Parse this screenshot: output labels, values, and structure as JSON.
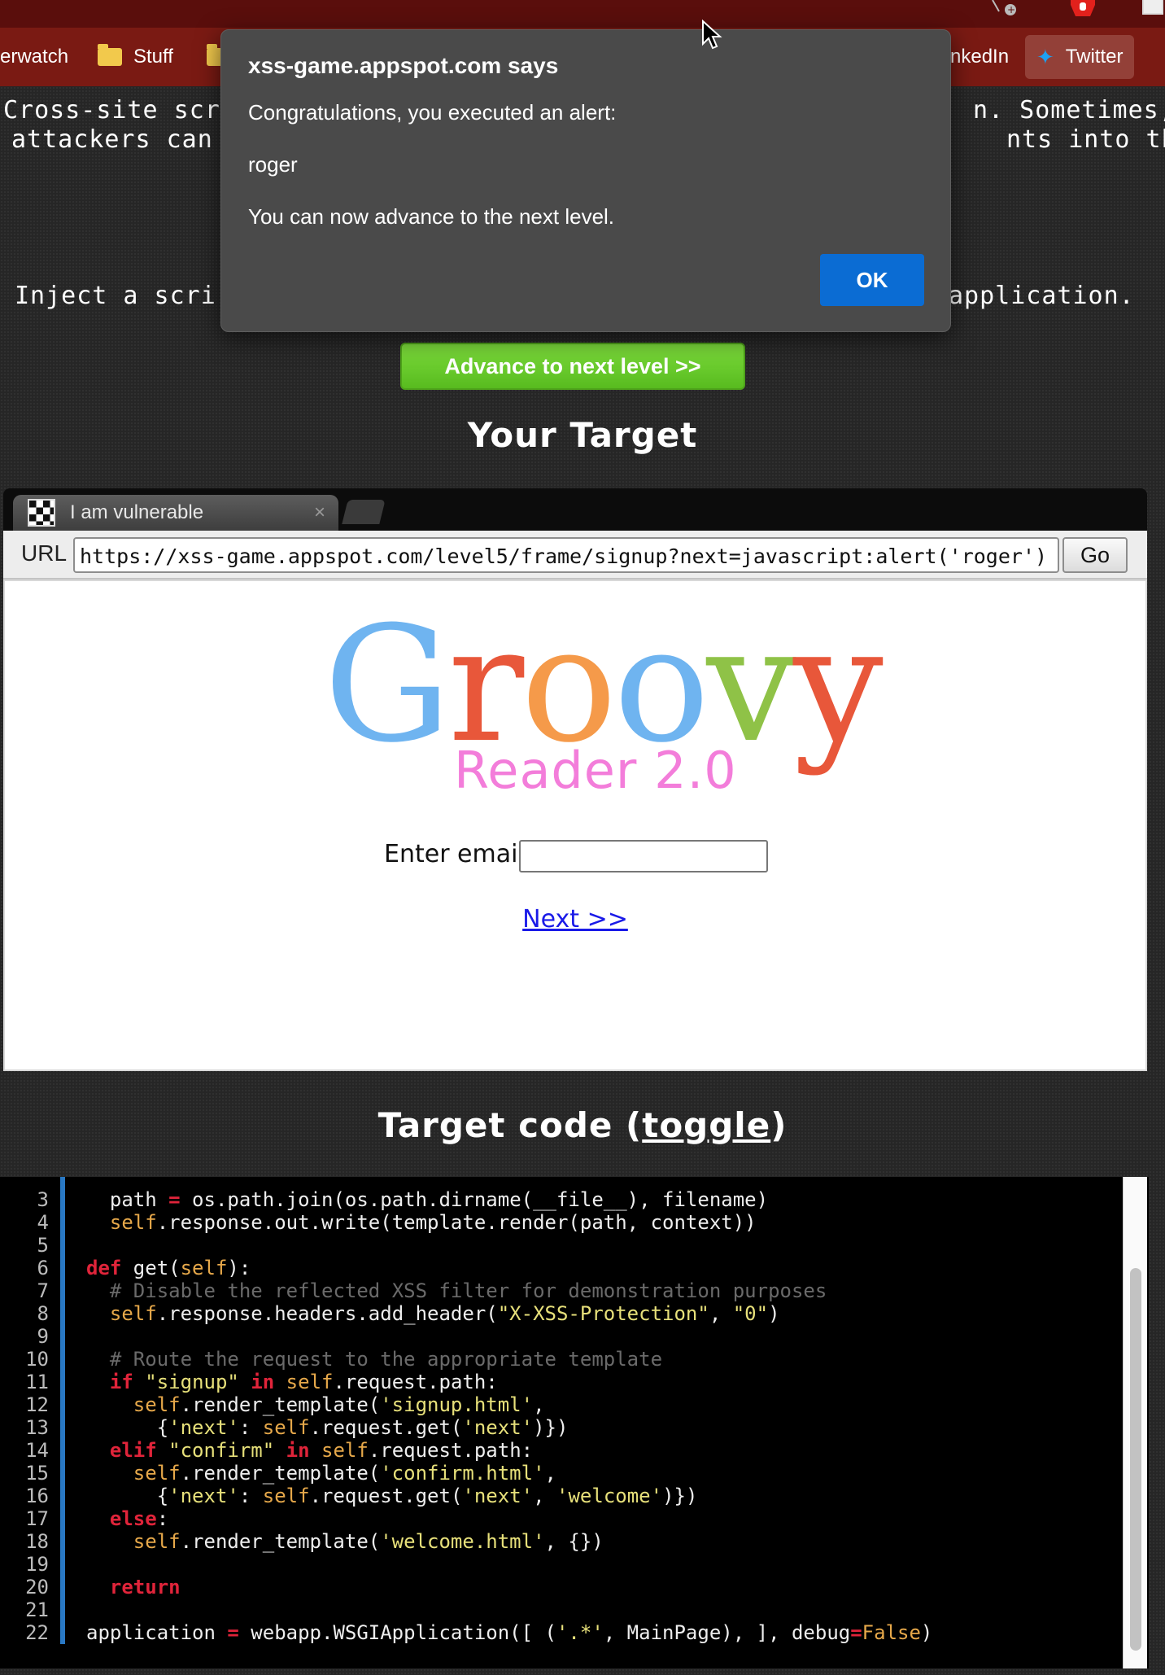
{
  "browser": {
    "bookmarks": [
      {
        "label": "erwatch"
      },
      {
        "label": "Stuff"
      },
      {
        "label": "nkedIn"
      },
      {
        "label": "Twitter"
      }
    ]
  },
  "page": {
    "intro_left_1": "Cross-site scr",
    "intro_right_1": "n. Sometimes,",
    "intro_left_2": "attackers can",
    "intro_right_2": "nts into the",
    "mission_left": "Inject a scri",
    "mission_right": "application.",
    "advance_button": "Advance to next level >>",
    "target_heading": "Your Target",
    "code_heading_prefix": "Target code (",
    "code_heading_link": "toggle",
    "code_heading_suffix": ")"
  },
  "frame": {
    "tab_title": "I am vulnerable",
    "url_label": "URL",
    "url_value": "https://xss-game.appspot.com/level5/frame/signup?next=javascript:alert('roger')",
    "go_button": "Go",
    "logo_word": [
      "G",
      "r",
      "o",
      "o",
      "v",
      "y"
    ],
    "logo_colors": [
      "#6fb4f0",
      "#e8573a",
      "#f59a4a",
      "#6fb4f0",
      "#8fc247",
      "#e8573a"
    ],
    "logo_subtitle": "Reader 2.0",
    "email_label": "Enter email:",
    "email_value": "",
    "next_link": "Next >>"
  },
  "code": {
    "lines": [
      {
        "n": "3",
        "html": "  path <span class=\"kw\">=</span> os.path.join(os.path.dirname(__file__), filename)"
      },
      {
        "n": "4",
        "html": "  <span class=\"self\">self</span>.response.out.write(template.render(path, context))"
      },
      {
        "n": "5",
        "html": ""
      },
      {
        "n": "6",
        "html": "<span class=\"kw\">def</span> get(<span class=\"self\">self</span>):"
      },
      {
        "n": "7",
        "html": "  <span class=\"cmt\"># Disable the reflected XSS filter for demonstration purposes</span>"
      },
      {
        "n": "8",
        "html": "  <span class=\"self\">self</span>.response.headers.add_header(<span class=\"str\">\"X-XSS-Protection\"</span>, <span class=\"str\">\"0\"</span>)"
      },
      {
        "n": "9",
        "html": ""
      },
      {
        "n": "10",
        "html": "  <span class=\"cmt\"># Route the request to the appropriate template</span>"
      },
      {
        "n": "11",
        "html": "  <span class=\"kw\">if</span> <span class=\"str\">\"signup\"</span> <span class=\"kw\">in</span> <span class=\"self\">self</span>.request.path:"
      },
      {
        "n": "12",
        "html": "    <span class=\"self\">self</span>.render_template(<span class=\"str\">'signup.html'</span>,"
      },
      {
        "n": "13",
        "html": "      {<span class=\"str\">'next'</span>: <span class=\"self\">self</span>.request.get(<span class=\"str\">'next'</span>)})"
      },
      {
        "n": "14",
        "html": "  <span class=\"kw\">elif</span> <span class=\"str\">\"confirm\"</span> <span class=\"kw\">in</span> <span class=\"self\">self</span>.request.path:"
      },
      {
        "n": "15",
        "html": "    <span class=\"self\">self</span>.render_template(<span class=\"str\">'confirm.html'</span>,"
      },
      {
        "n": "16",
        "html": "      {<span class=\"str\">'next'</span>: <span class=\"self\">self</span>.request.get(<span class=\"str\">'next'</span>, <span class=\"str\">'welcome'</span>)})"
      },
      {
        "n": "17",
        "html": "  <span class=\"kw\">else</span>:"
      },
      {
        "n": "18",
        "html": "    <span class=\"self\">self</span>.render_template(<span class=\"str\">'welcome.html'</span>, {})"
      },
      {
        "n": "19",
        "html": ""
      },
      {
        "n": "20",
        "html": "  <span class=\"kw\">return</span>"
      },
      {
        "n": "21",
        "html": ""
      },
      {
        "n": "22",
        "html": "application <span class=\"kw\">=</span> webapp.WSGIApplication([ (<span class=\"str\">'.*'</span>, MainPage), ], debug<span class=\"kw\">=</span><span class=\"self\">False</span>)"
      }
    ]
  },
  "dialog": {
    "title": "xss-game.appspot.com says",
    "message": "Congratulations, you executed an alert:",
    "value": "roger",
    "advance_text": "You can now advance to the next level.",
    "ok_button": "OK"
  },
  "colors": {
    "accent": "#0b6cd3",
    "advance_green": "#6fd02e",
    "bookmark_bar": "#7a1a13"
  }
}
